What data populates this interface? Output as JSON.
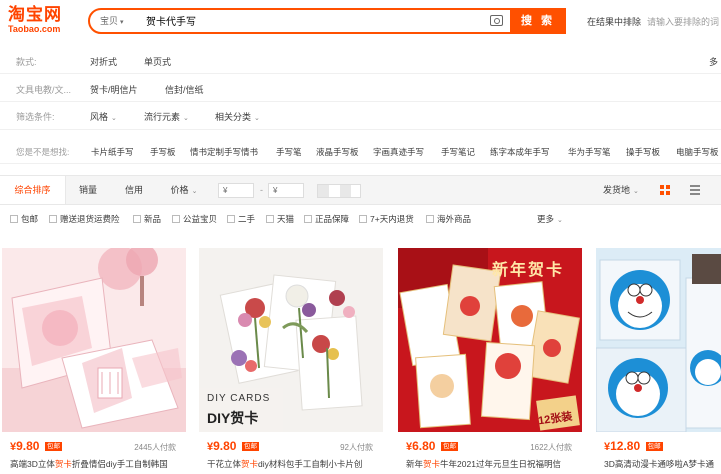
{
  "header": {
    "logo_cn": "淘宝网",
    "logo_en": "Taobao.com",
    "search_type": "宝贝",
    "search_value": "贺卡代手写",
    "search_button": "搜 索",
    "exclude_label": "在结果中排除",
    "exclude_placeholder": "请输入要排除的词"
  },
  "filters": {
    "style": {
      "label": "款式:",
      "options": [
        "对折式",
        "单页式"
      ],
      "more": "多"
    },
    "category": {
      "label": "文具电教/文...",
      "options": [
        "贺卡/明信片",
        "信封/信纸"
      ]
    },
    "conditions": {
      "label": "筛选条件:",
      "options": [
        "风格",
        "流行元素",
        "相关分类"
      ]
    }
  },
  "guess": {
    "label": "您是不是想找:",
    "items": [
      "卡片纸手写",
      "手写板",
      "情书定制手写情书",
      "手写笔",
      "液晶手写板",
      "字画真迹手写",
      "手写笔记",
      "练字本成年手写",
      "华为手写笔",
      "操手写板",
      "电脑手写板"
    ]
  },
  "sortbar": {
    "tabs": [
      "综合排序",
      "销量",
      "信用",
      "价格"
    ],
    "price_from": "¥",
    "price_to": "¥",
    "dash": "-",
    "ship_from": "发货地"
  },
  "checkboxes": [
    "包邮",
    "赠送退货运费险",
    "新品",
    "公益宝贝",
    "二手",
    "天猫",
    "正品保障",
    "7+天内退货",
    "海外商品"
  ],
  "more": "更多",
  "products": [
    {
      "price": "9.80",
      "badge": "包邮",
      "sold": "2445人付款",
      "title_pre": "高端3D立体",
      "title_hl": "贺卡",
      "title_post": "折叠情侣diy手工自制韩国"
    },
    {
      "price": "9.80",
      "badge": "包邮",
      "sold": "92人付款",
      "title_pre": "干花立体",
      "title_hl": "贺卡",
      "title_post": "diy材料包手工自制小卡片创",
      "img_text_1": "DIY CARDS",
      "img_text_2": "DIY贺卡"
    },
    {
      "price": "6.80",
      "badge": "包邮",
      "sold": "1622人付款",
      "title_pre": "新年",
      "title_hl": "贺卡",
      "title_post": "牛年2021过年元旦生日祝福明信",
      "img_text_1": "新年贺卡",
      "img_text_2": "12张装"
    },
    {
      "price": "12.80",
      "badge": "包邮",
      "sold": "",
      "title_pre": "3D高清动漫卡通哆啦A梦卡通",
      "title_hl": "",
      "title_post": ""
    }
  ],
  "colors": {
    "brand": "#ff4400",
    "search_border": "#ff5000"
  }
}
